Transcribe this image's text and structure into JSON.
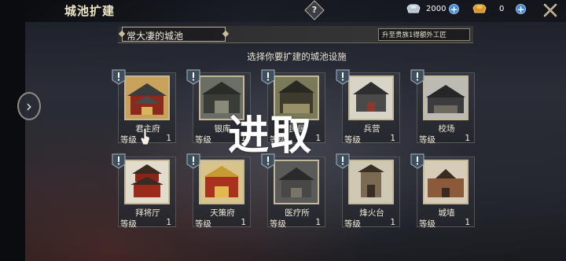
{
  "header": {
    "title": "城池扩建",
    "help": "?",
    "silver": "2000",
    "gold": "0"
  },
  "city": {
    "name": "常大凄的城池",
    "upgrade_hint": "升至贵族1得额外工匠"
  },
  "instruction": "选择你要扩建的城池设施",
  "level_label": "等级",
  "buildings": [
    {
      "name": "君主府",
      "level": "1"
    },
    {
      "name": "银库",
      "level": "1"
    },
    {
      "name": "民居",
      "level": "1"
    },
    {
      "name": "兵营",
      "level": "1"
    },
    {
      "name": "校场",
      "level": "1"
    },
    {
      "name": "拜将厅",
      "level": "1"
    },
    {
      "name": "天策府",
      "level": "1"
    },
    {
      "name": "医疗所",
      "level": "1"
    },
    {
      "name": "烽火台",
      "level": "1"
    },
    {
      "name": "城墙",
      "level": "1"
    }
  ],
  "overlay": "进取",
  "colors": {
    "accent_blue": "#3f86d6",
    "card_border": "#c5b899",
    "badge": "#3d4f5e"
  },
  "icons": [
    "help-icon",
    "silver-ingot-icon",
    "gold-ingot-icon",
    "close-icon",
    "arrow-right-icon",
    "alert-badge-icon",
    "hand-cursor-icon"
  ]
}
